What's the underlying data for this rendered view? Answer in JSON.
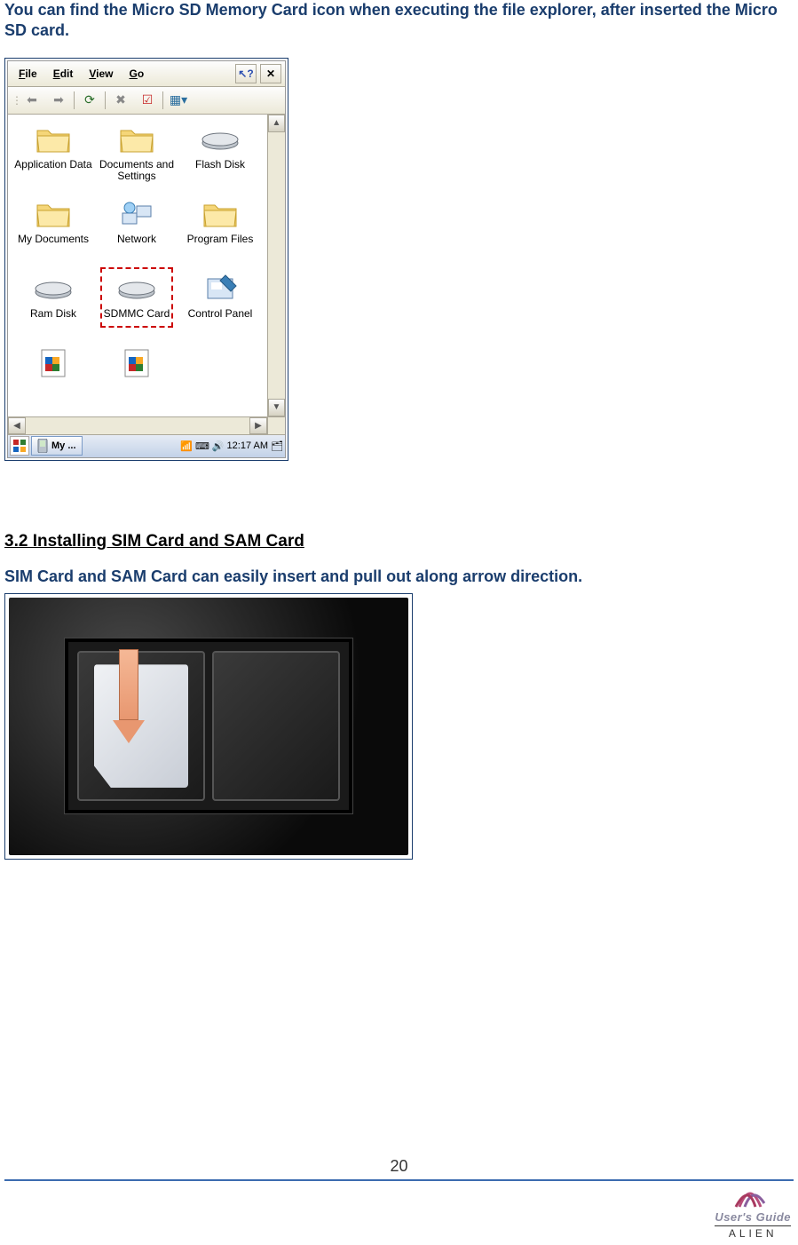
{
  "intro_text": "You can find the Micro SD Memory Card icon when executing the file explorer, after inserted the Micro SD card.",
  "file_explorer": {
    "menubar": {
      "file": "File",
      "edit": "Edit",
      "view": "View",
      "go": "Go"
    },
    "close_glyph": "✕",
    "help_glyph": "?",
    "items": [
      {
        "label": "Application Data",
        "type": "folder"
      },
      {
        "label": "Documents and Settings",
        "type": "folder"
      },
      {
        "label": "Flash Disk",
        "type": "disk"
      },
      {
        "label": "My Documents",
        "type": "folder"
      },
      {
        "label": "Network",
        "type": "network"
      },
      {
        "label": "Program Files",
        "type": "folder"
      },
      {
        "label": "Ram Disk",
        "type": "disk"
      },
      {
        "label": "SDMMC Card",
        "type": "disk",
        "highlight": true
      },
      {
        "label": "Control Panel",
        "type": "cpanel"
      }
    ],
    "taskbar": {
      "active_task": "My ...",
      "clock": "12:17 AM"
    }
  },
  "section": {
    "heading": "3.2 Installing SIM Card and SAM Card",
    "text": "SIM Card and SAM Card can easily insert and pull out along arrow direction."
  },
  "page_number": "20",
  "footer": {
    "guide_label": "User's Guide",
    "brand": "ALIEN"
  }
}
